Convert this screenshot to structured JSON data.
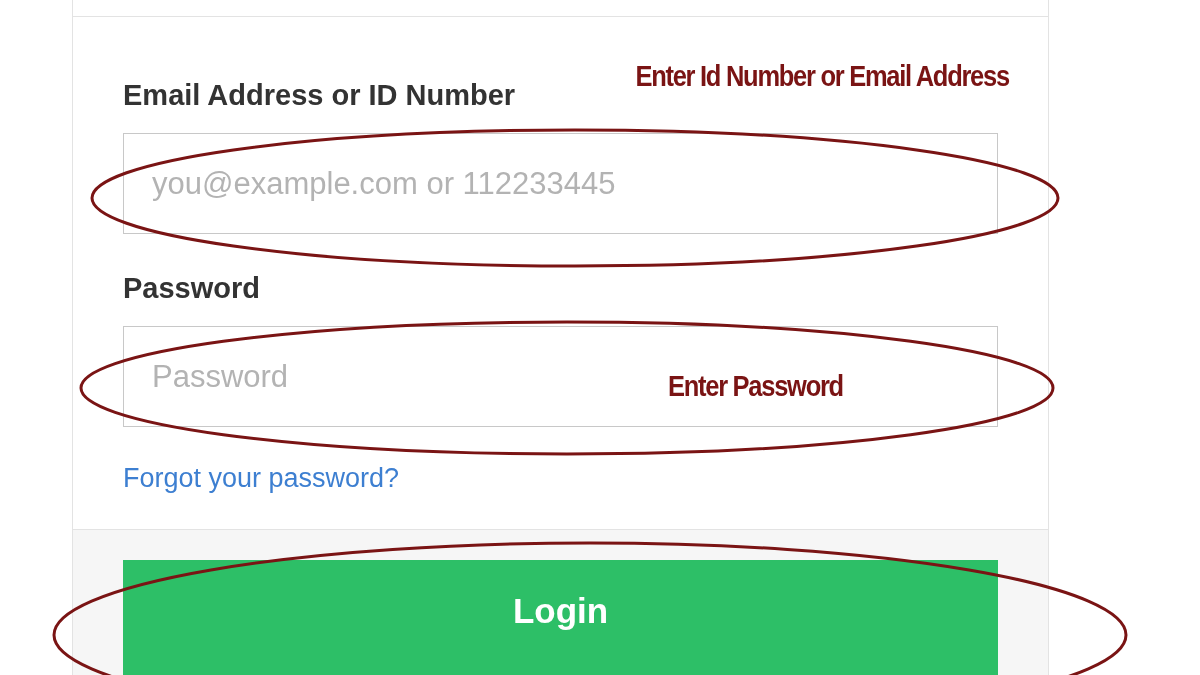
{
  "form": {
    "fields": [
      {
        "label": "Email Address or ID Number",
        "placeholder": "you@example.com or 112233445"
      },
      {
        "label": "Password",
        "placeholder": "Password"
      }
    ],
    "link": "Forgot your password?",
    "button": "Login"
  },
  "annotations": [
    "Enter Id Number or Email Address",
    "Enter Password"
  ]
}
